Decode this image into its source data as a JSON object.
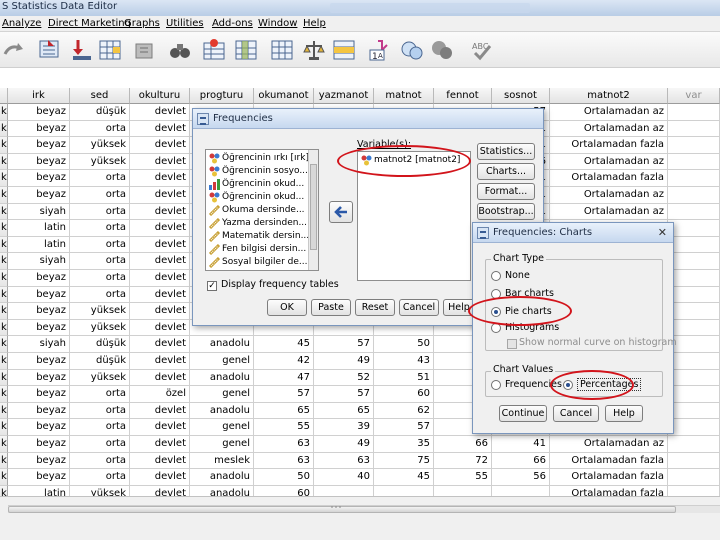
{
  "window": {
    "title": "S Statistics Data Editor"
  },
  "menu": [
    "Analyze",
    "Direct Marketing",
    "Graphs",
    "Utilities",
    "Add-ons",
    "Window",
    "Help"
  ],
  "columns": [
    "irk",
    "sed",
    "okulturu",
    "progturu",
    "okumanot",
    "yazmanot",
    "matnot",
    "fennot",
    "sosnot",
    "matnot2",
    "var"
  ],
  "row_markers": [
    "k",
    "k",
    "k",
    "k",
    "k",
    "k",
    "k",
    "k",
    "k",
    "k",
    "k",
    "k",
    "k",
    "k",
    "k",
    "k",
    "k",
    "k",
    "k",
    "k",
    "k",
    "k",
    "k",
    "k",
    "k"
  ],
  "rows": [
    [
      "beyaz",
      "düşük",
      "devlet",
      "",
      "",
      "",
      "",
      "",
      "57",
      "Ortalamadan az"
    ],
    [
      "beyaz",
      "orta",
      "devlet",
      "",
      "",
      "",
      "",
      "",
      "61",
      "Ortalamadan az"
    ],
    [
      "beyaz",
      "yüksek",
      "devlet",
      "",
      "",
      "",
      "",
      "",
      "31",
      "Ortalamadan fazla"
    ],
    [
      "beyaz",
      "yüksek",
      "devlet",
      "",
      "",
      "",
      "",
      "",
      "56",
      "Ortalamadan az"
    ],
    [
      "beyaz",
      "orta",
      "devlet",
      "",
      "",
      "",
      "",
      "",
      "61",
      "Ortalamadan fazla"
    ],
    [
      "beyaz",
      "orta",
      "devlet",
      "",
      "",
      "",
      "",
      "",
      "61",
      "Ortalamadan az"
    ],
    [
      "siyah",
      "orta",
      "devlet",
      "",
      "",
      "",
      "",
      "",
      "61",
      "Ortalamadan az"
    ],
    [
      "latin",
      "orta",
      "devlet",
      "",
      "",
      "",
      "",
      "",
      "",
      "Ortalamadan az"
    ],
    [
      "latin",
      "orta",
      "devlet",
      "",
      "",
      "",
      "",
      "",
      "",
      "Ortalamadan az"
    ],
    [
      "siyah",
      "orta",
      "devlet",
      "",
      "",
      "",
      "",
      "",
      "",
      "Ortalamadan az"
    ],
    [
      "beyaz",
      "orta",
      "devlet",
      "",
      "",
      "",
      "",
      "",
      "",
      "Ortalamadan az"
    ],
    [
      "beyaz",
      "orta",
      "devlet",
      "",
      "",
      "",
      "",
      "",
      "",
      "Ortalamadan az"
    ],
    [
      "beyaz",
      "yüksek",
      "devlet",
      "",
      "",
      "",
      "",
      "",
      "",
      "Ortalamadan az"
    ],
    [
      "beyaz",
      "yüksek",
      "devlet",
      "",
      "",
      "",
      "",
      "",
      "",
      "Ortalamadan az"
    ],
    [
      "siyah",
      "düşük",
      "devlet",
      "anadolu",
      "45",
      "57",
      "50",
      "",
      "",
      "Ortalamadan az"
    ],
    [
      "beyaz",
      "düşük",
      "devlet",
      "genel",
      "42",
      "49",
      "43",
      "",
      "",
      "Ortalamadan az"
    ],
    [
      "beyaz",
      "yüksek",
      "devlet",
      "anadolu",
      "47",
      "52",
      "51",
      "",
      "",
      "Ortalamadan az"
    ],
    [
      "beyaz",
      "orta",
      "özel",
      "genel",
      "57",
      "57",
      "60",
      "",
      "",
      "Ortalamadan az"
    ],
    [
      "beyaz",
      "orta",
      "devlet",
      "anadolu",
      "65",
      "65",
      "62",
      "",
      "",
      "Ortalamadan az"
    ],
    [
      "beyaz",
      "orta",
      "devlet",
      "genel",
      "55",
      "39",
      "57",
      "",
      "",
      "Ortalamadan az"
    ],
    [
      "beyaz",
      "orta",
      "devlet",
      "genel",
      "63",
      "49",
      "35",
      "66",
      "41",
      "Ortalamadan az"
    ],
    [
      "beyaz",
      "orta",
      "devlet",
      "meslek",
      "63",
      "63",
      "75",
      "72",
      "66",
      "Ortalamadan fazla"
    ],
    [
      "beyaz",
      "orta",
      "devlet",
      "anadolu",
      "50",
      "40",
      "45",
      "55",
      "56",
      "Ortalamadan fazla"
    ],
    [
      "latin",
      "yüksek",
      "devlet",
      "anadolu",
      "60",
      "",
      "",
      "",
      "",
      "Ortalamadan fazla"
    ]
  ],
  "freq_dialog": {
    "title": "Frequencies",
    "variables_label": "Variable(s):",
    "selected_var": "matnot2 [matnot2]",
    "source_list": [
      "Öğrencinin ırkı [ırk]",
      "Öğrencinin sosyo...",
      "Öğrencinin okud...",
      "Öğrencinin okud...",
      "Okuma dersinde...",
      "Yazma dersinden...",
      "Matematik dersin...",
      "Fen bilgisi dersin...",
      "Sosyal bilgiler de..."
    ],
    "side_buttons": [
      "Statistics...",
      "Charts...",
      "Format...",
      "Bootstrap..."
    ],
    "display_label": "Display frequency tables",
    "bottom_buttons": [
      "OK",
      "Paste",
      "Reset",
      "Cancel",
      "Help"
    ]
  },
  "charts_dialog": {
    "title": "Frequencies: Charts",
    "chart_type_label": "Chart Type",
    "chart_types": [
      "None",
      "Bar charts",
      "Pie charts",
      "Histograms"
    ],
    "normal_curve": "Show normal curve on histogram",
    "chart_values_label": "Chart Values",
    "values": [
      "Frequencies",
      "Percentages"
    ],
    "buttons": [
      "Continue",
      "Cancel",
      "Help"
    ]
  },
  "colors": {
    "highlight": "#d2141b",
    "dialog_bg": "#f0f0f0"
  }
}
